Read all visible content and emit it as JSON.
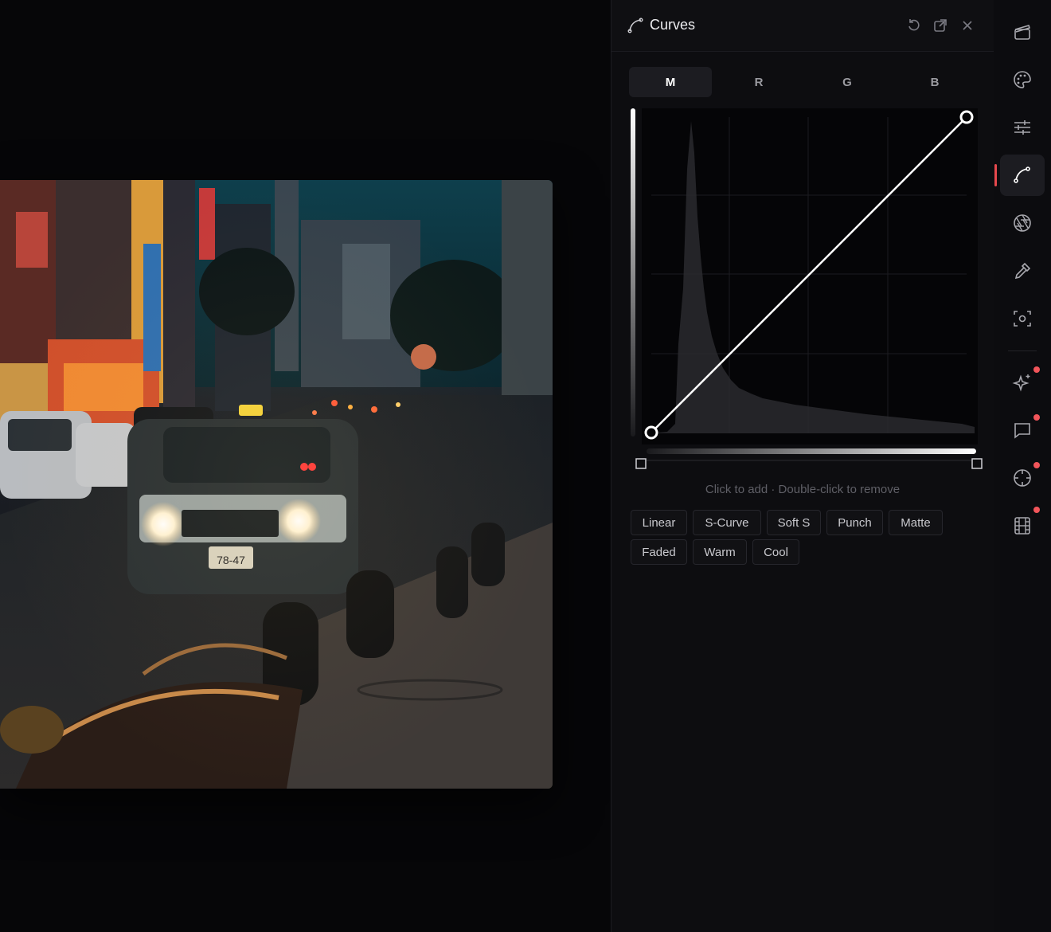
{
  "panel": {
    "title": "Curves",
    "title_icon": "curve-icon",
    "header_actions": [
      "reset-icon",
      "popout-icon",
      "close-icon"
    ]
  },
  "channels": {
    "active": "M",
    "tabs": [
      {
        "label": "M"
      },
      {
        "label": "R"
      },
      {
        "label": "G"
      },
      {
        "label": "B"
      }
    ]
  },
  "curve": {
    "points": [
      {
        "input": 0,
        "output": 0
      },
      {
        "input": 255,
        "output": 255
      }
    ]
  },
  "hint": "Click to add · Double-click to remove",
  "presets": {
    "row1": [
      "Linear",
      "S-Curve",
      "Soft S",
      "Punch",
      "Matte"
    ],
    "row2": [
      "Faded",
      "Warm",
      "Cool"
    ]
  },
  "photo": {
    "plate_text": "78-47"
  },
  "rail": {
    "items": [
      {
        "icon": "clapperboard-icon"
      },
      {
        "icon": "palette-icon"
      },
      {
        "icon": "sliders-icon"
      },
      {
        "icon": "curve-icon",
        "active": true
      },
      {
        "icon": "aperture-icon"
      },
      {
        "icon": "eyedropper-icon"
      },
      {
        "icon": "focus-icon"
      },
      {
        "icon": "sparkle-icon",
        "badge": true
      },
      {
        "icon": "comment-icon",
        "badge": true
      },
      {
        "icon": "crosshair-icon",
        "badge": true
      },
      {
        "icon": "film-icon",
        "badge": true
      }
    ]
  },
  "colors": {
    "accent": "#e5484d",
    "panel_bg": "#0d0d10",
    "curve_line": "#ffffff"
  }
}
